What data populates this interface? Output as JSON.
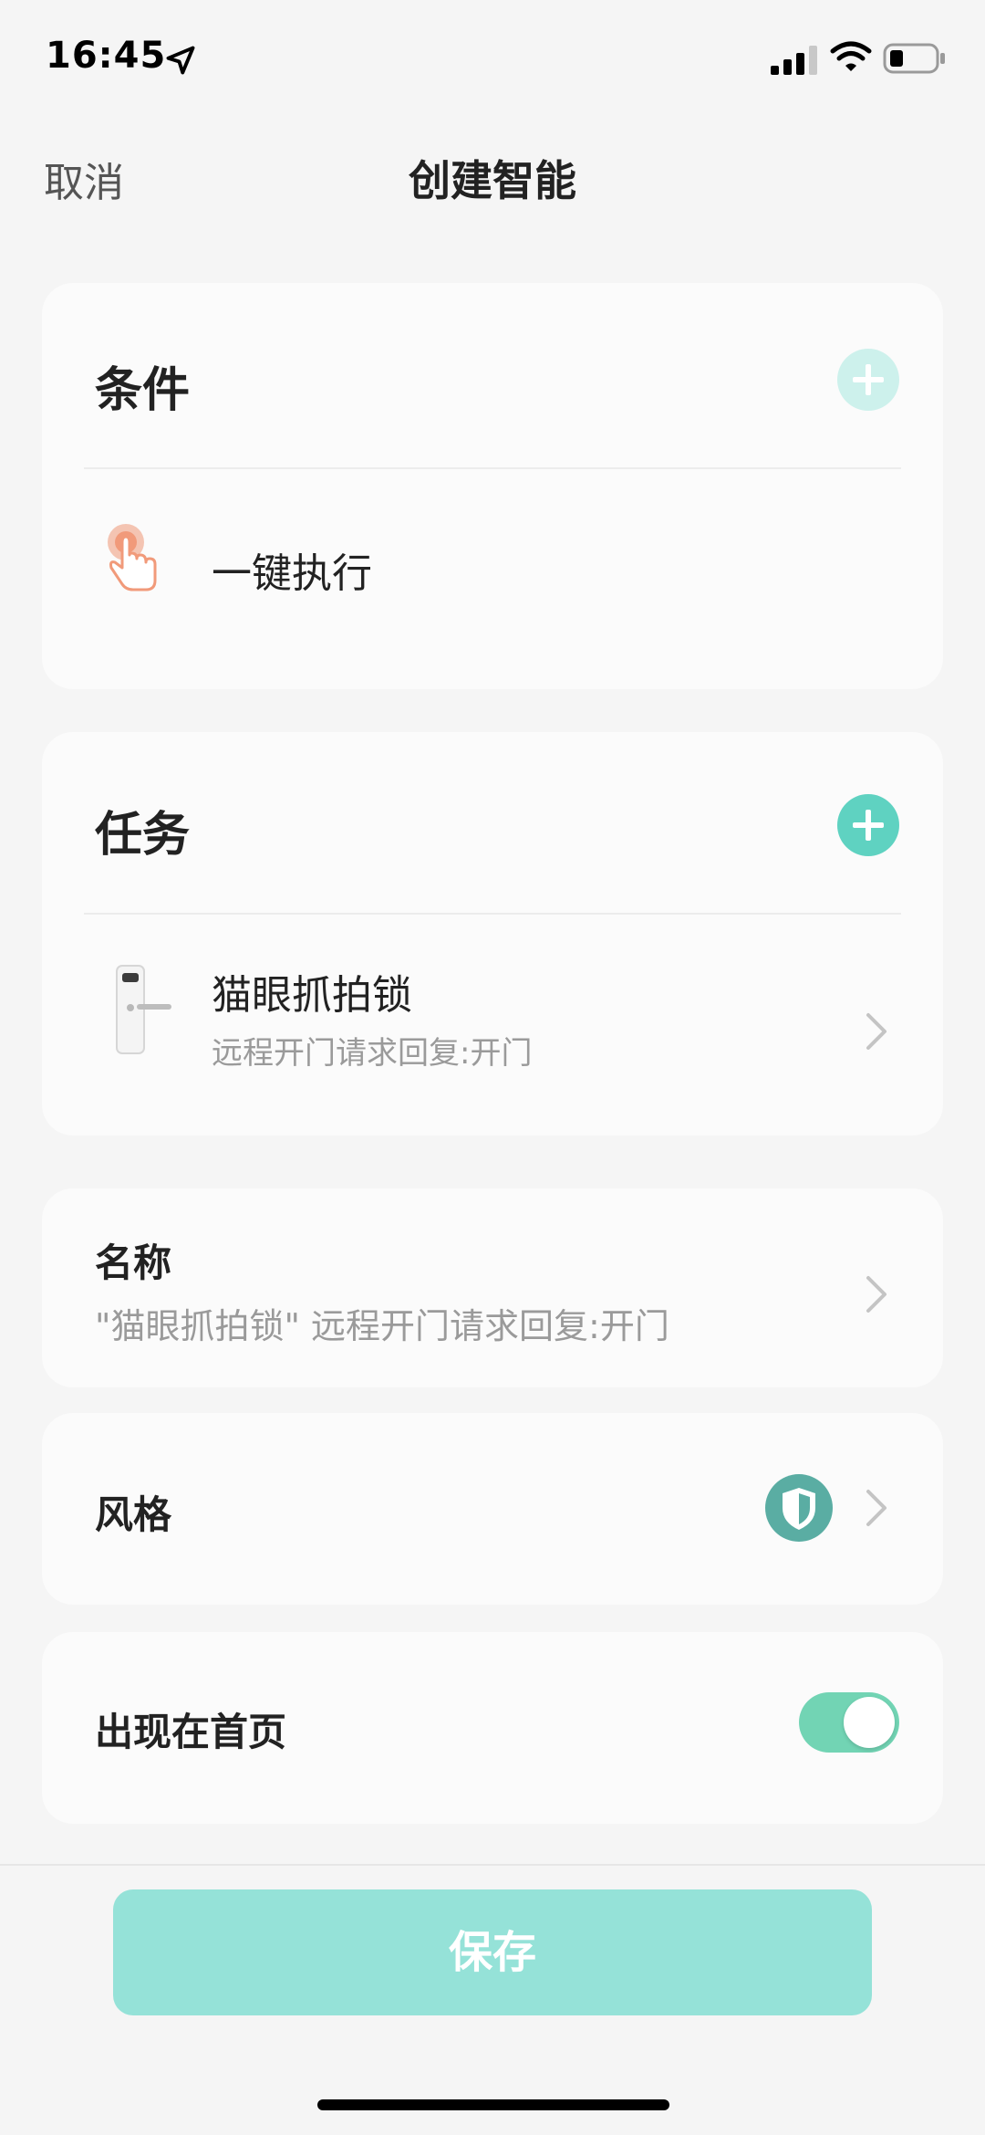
{
  "status_bar": {
    "time": "16:45",
    "icons": [
      "location-arrow-icon",
      "signal-icon",
      "wifi-icon",
      "battery-icon"
    ]
  },
  "nav": {
    "cancel": "取消",
    "title": "创建智能"
  },
  "condition_section": {
    "title": "条件",
    "add_icon": "plus-icon",
    "item": {
      "icon": "tap-hand-icon",
      "label": "一键执行"
    }
  },
  "task_section": {
    "title": "任务",
    "add_icon": "plus-icon",
    "item": {
      "icon": "door-lock-icon",
      "title": "猫眼抓拍锁",
      "subtitle": "远程开门请求回复:开门"
    }
  },
  "name_row": {
    "label": "名称",
    "value": "\"猫眼抓拍锁\" 远程开门请求回复:开门"
  },
  "style_row": {
    "label": "风格",
    "icon": "shield-icon"
  },
  "homepage_row": {
    "label": "出现在首页",
    "toggle_on": true
  },
  "footer": {
    "save": "保存"
  },
  "colors": {
    "accent": "#5fd2c1",
    "accent_disabled": "#cdf1ec",
    "save_button": "#95e2d8",
    "toggle_on": "#72d4b4",
    "style_icon_bg": "#5aada3",
    "hand_icon": "#f19a7a"
  }
}
